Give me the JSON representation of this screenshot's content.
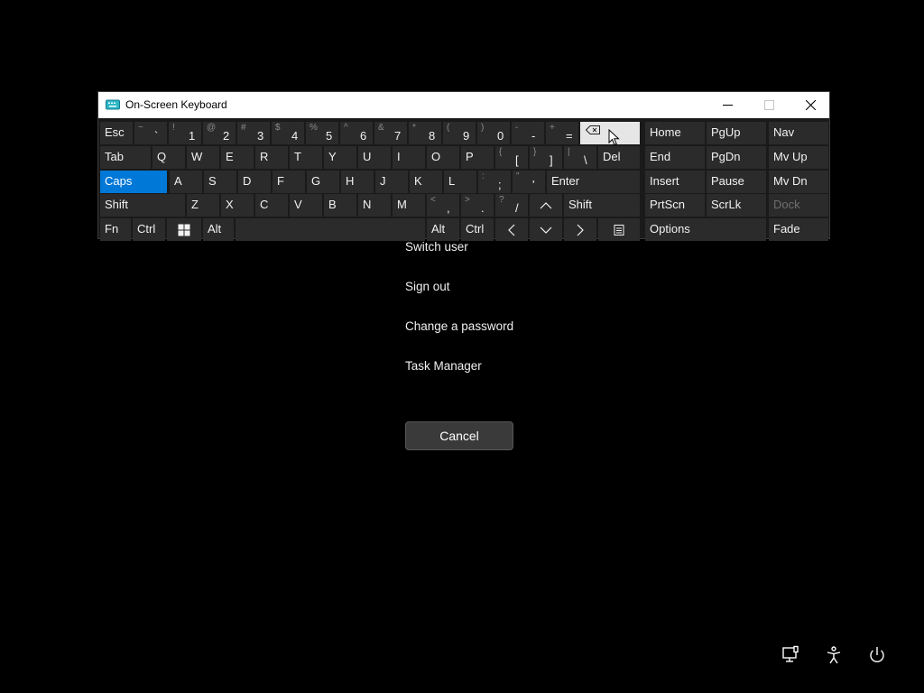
{
  "osk": {
    "title": "On-Screen Keyboard",
    "rows": [
      [
        {
          "l": "Esc"
        },
        {
          "s": "~",
          "m": "`"
        },
        {
          "s": "!",
          "m": "1"
        },
        {
          "s": "@",
          "m": "2"
        },
        {
          "s": "#",
          "m": "3"
        },
        {
          "s": "$",
          "m": "4"
        },
        {
          "s": "%",
          "m": "5"
        },
        {
          "s": "^",
          "m": "6"
        },
        {
          "s": "&",
          "m": "7"
        },
        {
          "s": "*",
          "m": "8"
        },
        {
          "s": "(",
          "m": "9"
        },
        {
          "s": ")",
          "m": "0"
        },
        {
          "s": "-",
          "m": "-"
        },
        {
          "s": "+",
          "m": "="
        },
        {
          "icon": "backspace-icon",
          "state": "hover"
        },
        {
          "l": "Home"
        },
        {
          "l": "PgUp"
        },
        {
          "l": "Nav"
        }
      ],
      [
        {
          "l": "Tab"
        },
        {
          "l": "Q"
        },
        {
          "l": "W"
        },
        {
          "l": "E"
        },
        {
          "l": "R"
        },
        {
          "l": "T"
        },
        {
          "l": "Y"
        },
        {
          "l": "U"
        },
        {
          "l": "I"
        },
        {
          "l": "O"
        },
        {
          "l": "P"
        },
        {
          "s": "{",
          "m": "["
        },
        {
          "s": "}",
          "m": "]"
        },
        {
          "s": "|",
          "m": "\\"
        },
        {
          "l": "Del"
        },
        {
          "l": "End"
        },
        {
          "l": "PgDn"
        },
        {
          "l": "Mv Up"
        }
      ],
      [
        {
          "l": "Caps",
          "state": "active"
        },
        {
          "l": "A"
        },
        {
          "l": "S"
        },
        {
          "l": "D"
        },
        {
          "l": "F"
        },
        {
          "l": "G"
        },
        {
          "l": "H"
        },
        {
          "l": "J"
        },
        {
          "l": "K"
        },
        {
          "l": "L"
        },
        {
          "s": ":",
          "m": ";"
        },
        {
          "s": "\"",
          "m": "'"
        },
        {
          "l": "Enter"
        },
        {
          "l": "Insert"
        },
        {
          "l": "Pause"
        },
        {
          "l": "Mv Dn"
        }
      ],
      [
        {
          "l": "Shift"
        },
        {
          "l": "Z"
        },
        {
          "l": "X"
        },
        {
          "l": "C"
        },
        {
          "l": "V"
        },
        {
          "l": "B"
        },
        {
          "l": "N"
        },
        {
          "l": "M"
        },
        {
          "s": "<",
          "m": ","
        },
        {
          "s": ">",
          "m": "."
        },
        {
          "s": "?",
          "m": "/"
        },
        {
          "icon": "arrow-up-icon"
        },
        {
          "l": "Shift"
        },
        {
          "l": "PrtScn"
        },
        {
          "l": "ScrLk"
        },
        {
          "l": "Dock",
          "state": "disabled"
        }
      ],
      [
        {
          "l": "Fn"
        },
        {
          "l": "Ctrl"
        },
        {
          "icon": "windows-logo-icon"
        },
        {
          "l": "Alt"
        },
        {
          "l": ""
        },
        {
          "l": "Alt"
        },
        {
          "l": "Ctrl"
        },
        {
          "icon": "arrow-left-icon"
        },
        {
          "icon": "arrow-down-icon"
        },
        {
          "icon": "arrow-right-icon"
        },
        {
          "icon": "context-menu-icon"
        },
        {
          "l": "Options"
        },
        {
          "l": "Fade"
        }
      ]
    ]
  },
  "menu": {
    "items": [
      "Switch user",
      "Sign out",
      "Change a password",
      "Task Manager"
    ],
    "cancel_label": "Cancel"
  },
  "tray": {
    "icons": [
      "network-icon",
      "accessibility-icon",
      "power-icon"
    ]
  },
  "colors": {
    "background": "#000000",
    "accent": "#0078d7",
    "key": "#2b2b2b",
    "key_hover": "#e6e6e6"
  }
}
